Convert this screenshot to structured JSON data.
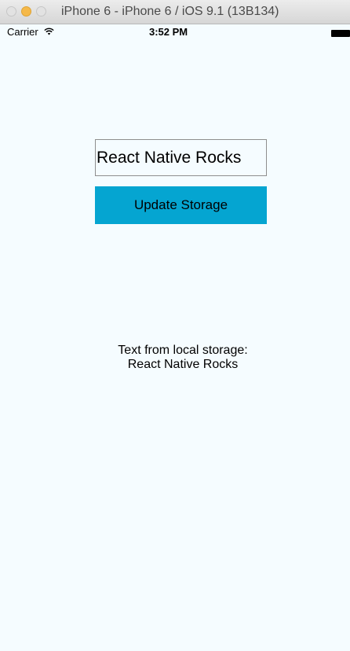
{
  "window": {
    "title": "iPhone 6 - iPhone 6 / iOS 9.1 (13B134)"
  },
  "status_bar": {
    "carrier": "Carrier",
    "wifi_icon": "wifi-icon",
    "time": "3:52 PM",
    "battery_icon": "battery-icon"
  },
  "form": {
    "input_value": "React Native Rocks",
    "button_label": "Update Storage",
    "button_color": "#05a5d1"
  },
  "storage": {
    "label": "Text from local storage:",
    "value": "React Native Rocks"
  },
  "colors": {
    "background": "#f5fcff",
    "accent": "#05a5d1",
    "minimize": "#f5b94a"
  }
}
